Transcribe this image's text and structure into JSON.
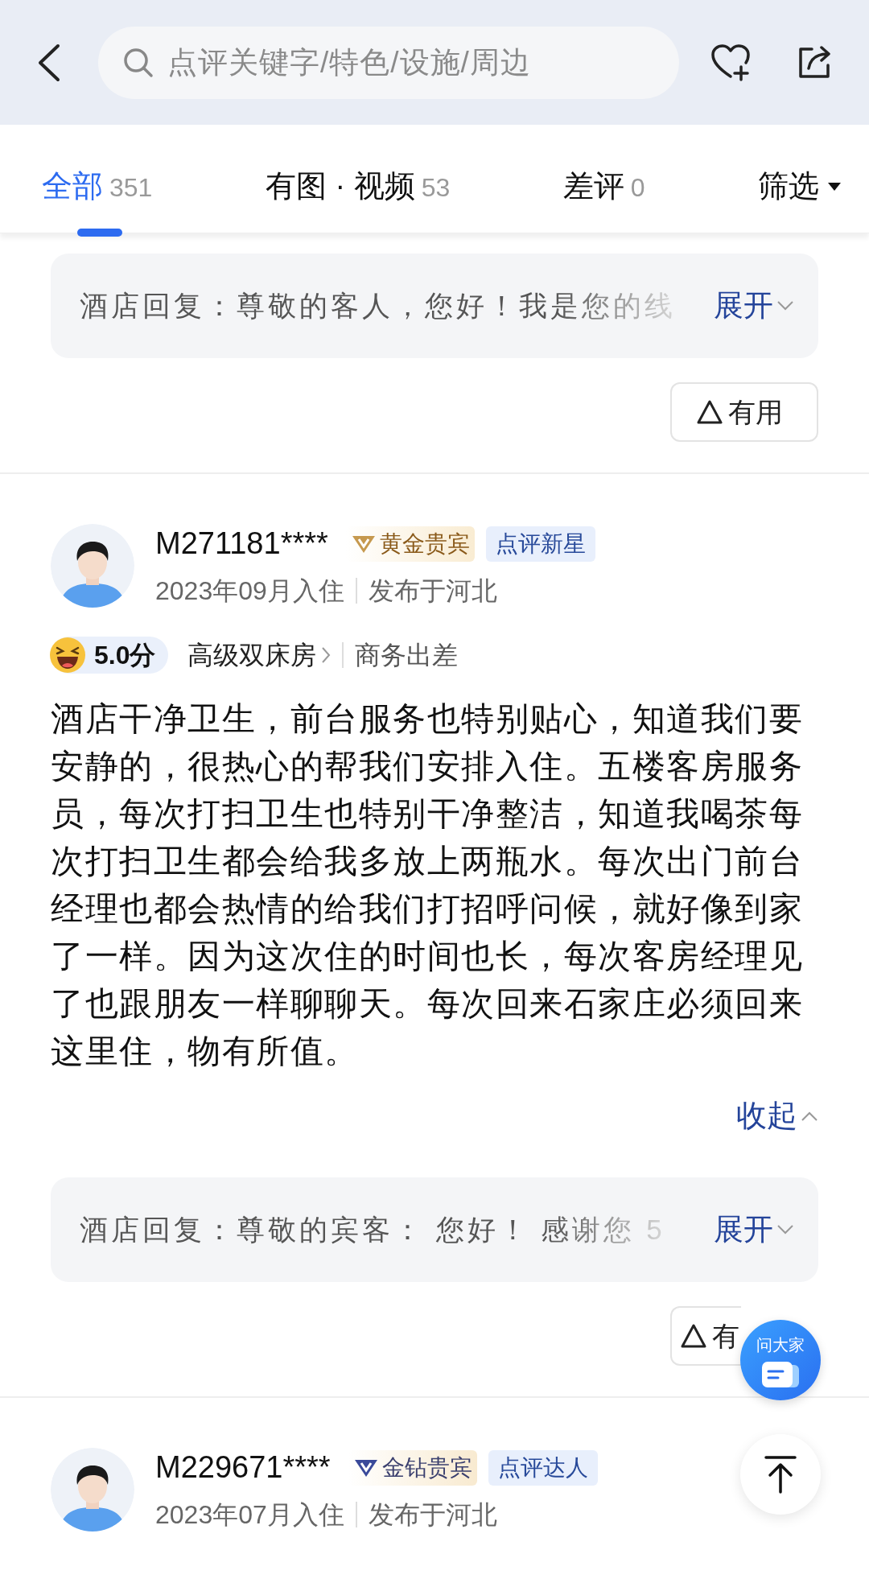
{
  "header": {
    "search": {
      "placeholder": "点评关键字/特色/设施/周边"
    }
  },
  "tabs": [
    {
      "label": "全部",
      "count": "351",
      "selected": true
    },
    {
      "label": "有图 · 视频",
      "count": "53",
      "selected": false
    },
    {
      "label": "差评",
      "count": "0",
      "selected": false
    }
  ],
  "filter": {
    "label": "筛选"
  },
  "previous_review": {
    "reply": {
      "text": "酒店回复：尊敬的客人，您好！我是您的线",
      "expand": "展开"
    },
    "helpful": "有用"
  },
  "reviews": [
    {
      "user": "M271181****",
      "member_badge": {
        "label": "黄金贵宾",
        "kind": "gold"
      },
      "level_badge": "点评新星",
      "stay": "2023年09月入住",
      "location": "发布于河北",
      "score": "5.0分",
      "room": "高级双床房",
      "trip": "商务出差",
      "body": "酒店干净卫生，前台服务也特别贴心，知道我们要安静的，很热心的帮我们安排入住。五楼客房服务员，每次打扫卫生也特别干净整洁，知道我喝茶每次打扫卫生都会给我多放上两瓶水。每次出门前台经理也都会热情的给我们打招呼问候，就好像到家了一样。因为这次住的时间也长，每次客房经理见了也跟朋友一样聊聊天。每次回来石家庄必须回来这里住，物有所值。",
      "collapse": "收起",
      "reply": {
        "text": "酒店回复：尊敬的宾客： 您好！ 感谢您 5",
        "expand": "展开"
      },
      "helpful": "有"
    },
    {
      "user": "M229671****",
      "member_badge": {
        "label": "金钻贵宾",
        "kind": "diamond"
      },
      "level_badge": "点评达人",
      "stay": "2023年07月入住",
      "location": "发布于河北"
    }
  ],
  "floating": {
    "ask": "问大家"
  }
}
